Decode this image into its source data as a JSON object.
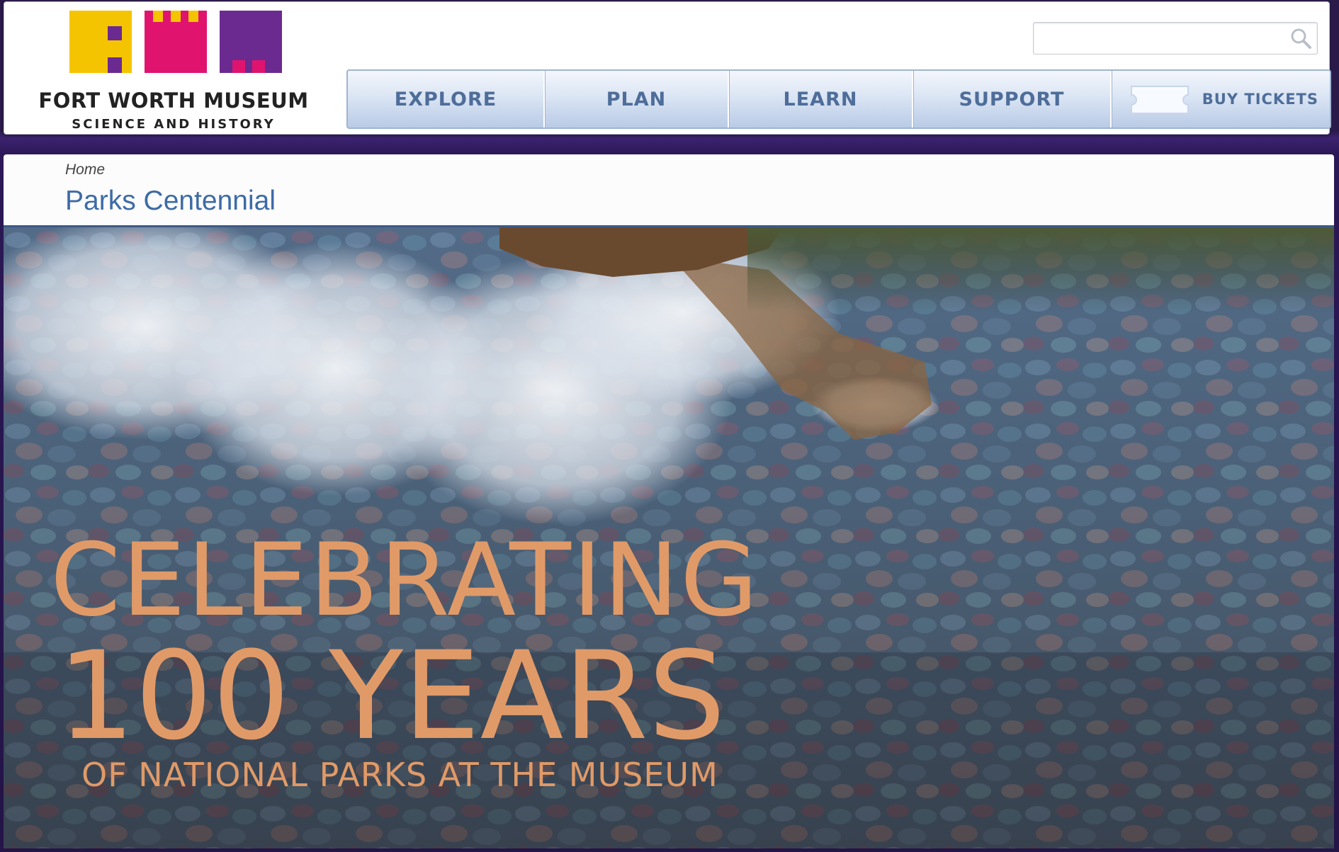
{
  "site": {
    "logo_line1": "FORT WORTH MUSEUM",
    "logo_line2": "SCIENCE AND HISTORY",
    "brand_colors": {
      "yellow": "#f5c400",
      "magenta": "#e0146e",
      "purple": "#6b2a90"
    }
  },
  "search": {
    "value": "",
    "placeholder": "",
    "icon": "search-icon"
  },
  "nav": {
    "items": [
      {
        "label": "EXPLORE"
      },
      {
        "label": "PLAN"
      },
      {
        "label": "LEARN"
      },
      {
        "label": "SUPPORT"
      },
      {
        "label": "BUY TICKETS",
        "icon": "ticket-icon"
      }
    ],
    "text_color": "#4e6d99"
  },
  "breadcrumb": {
    "home": "Home"
  },
  "page": {
    "title": "Parks Centennial"
  },
  "hero": {
    "line1": "CELEBRATING",
    "line2": "100 YEARS",
    "line3": "OF NATIONAL PARKS AT THE MUSEUM",
    "text_color": "#e09a68",
    "image": "clear-lake-pebbles-with-cloud-and-mountain-reflection"
  }
}
